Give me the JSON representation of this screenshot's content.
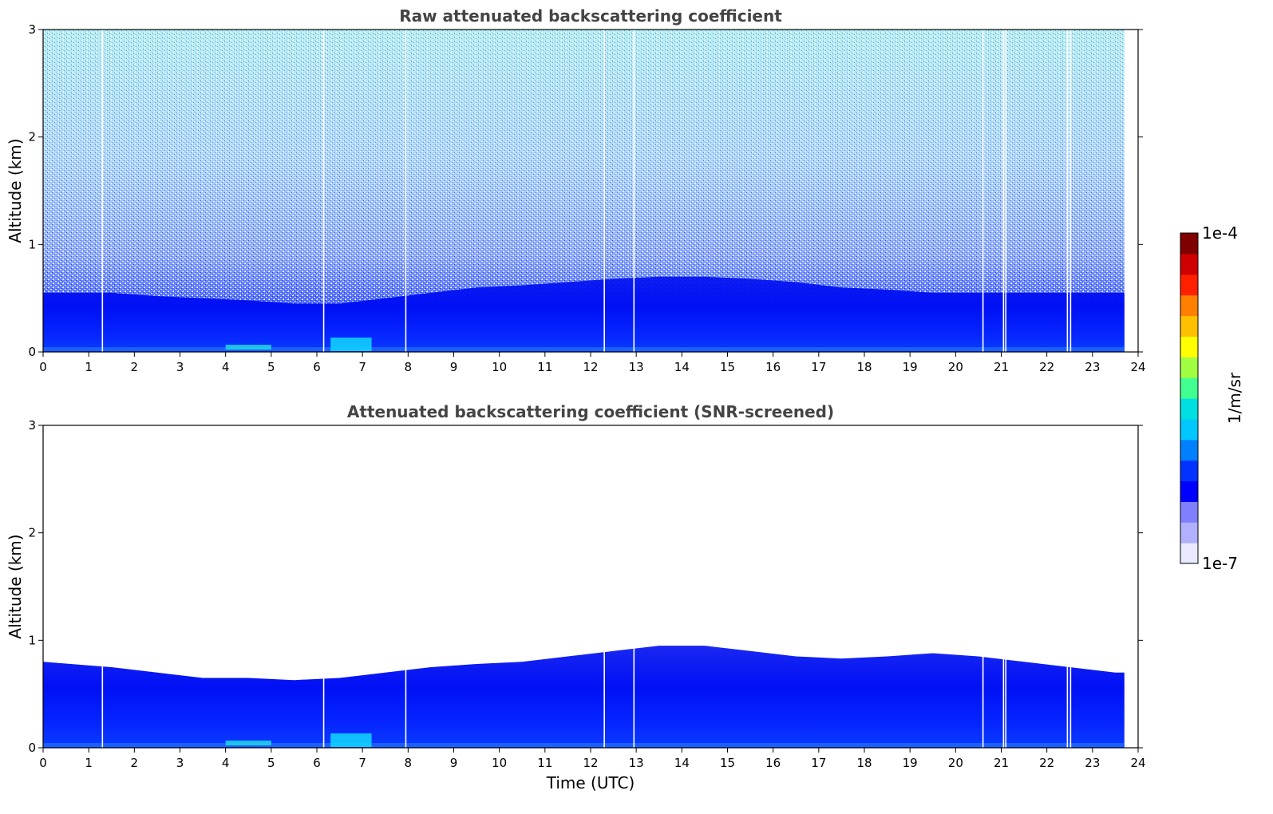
{
  "chart_data": [
    {
      "type": "heatmap",
      "title": "Raw attenuated backscattering coefficient",
      "xlabel": "",
      "ylabel": "Altitude (km)",
      "xlim": [
        0,
        24
      ],
      "ylim": [
        0,
        3
      ],
      "xticks": [
        0,
        1,
        2,
        3,
        4,
        5,
        6,
        7,
        8,
        9,
        10,
        11,
        12,
        13,
        14,
        15,
        16,
        17,
        18,
        19,
        20,
        21,
        22,
        23,
        24
      ],
      "yticks": [
        0,
        1,
        2,
        3
      ],
      "data_end_time": 23.7,
      "data_gaps_time": [
        1.3,
        6.15,
        7.95,
        12.3,
        12.95,
        20.6,
        21.05,
        21.1,
        22.45,
        22.52
      ],
      "noise_floor_altitude_km": 3,
      "boundary_layer_top_km": [
        0.55,
        0.55,
        0.52,
        0.5,
        0.48,
        0.45,
        0.45,
        0.5,
        0.55,
        0.6,
        0.62,
        0.65,
        0.68,
        0.7,
        0.7,
        0.68,
        0.65,
        0.6,
        0.58,
        0.55,
        0.55,
        0.55,
        0.55,
        0.55
      ]
    },
    {
      "type": "heatmap",
      "title": "Attenuated backscattering coefficient (SNR-screened)",
      "xlabel": "Time (UTC)",
      "ylabel": "Altitude (km)",
      "xlim": [
        0,
        24
      ],
      "ylim": [
        0,
        3
      ],
      "xticks": [
        0,
        1,
        2,
        3,
        4,
        5,
        6,
        7,
        8,
        9,
        10,
        11,
        12,
        13,
        14,
        15,
        16,
        17,
        18,
        19,
        20,
        21,
        22,
        23,
        24
      ],
      "yticks": [
        0,
        1,
        2,
        3
      ],
      "data_end_time": 23.7,
      "data_gaps_time": [
        1.3,
        6.15,
        7.95,
        12.3,
        12.95,
        20.6,
        21.05,
        21.1,
        22.45,
        22.52
      ],
      "boundary_layer_top_km": [
        0.8,
        0.75,
        0.7,
        0.65,
        0.65,
        0.63,
        0.65,
        0.7,
        0.75,
        0.78,
        0.8,
        0.85,
        0.9,
        0.95,
        0.95,
        0.9,
        0.85,
        0.83,
        0.85,
        0.88,
        0.85,
        0.8,
        0.75,
        0.7
      ]
    }
  ],
  "colorbar": {
    "label": "1/m/sr",
    "max_label": "1e-4",
    "min_label": "1e-7",
    "scale": "log",
    "range": [
      1e-07,
      0.0001
    ],
    "colors": [
      "#e8e8ff",
      "#b0b0ff",
      "#8080ff",
      "#0000ff",
      "#0033ff",
      "#0080ff",
      "#00c8ff",
      "#00e0e0",
      "#40ff90",
      "#a0ff40",
      "#ffff00",
      "#ffc000",
      "#ff8000",
      "#ff2000",
      "#d00000",
      "#800000"
    ]
  }
}
